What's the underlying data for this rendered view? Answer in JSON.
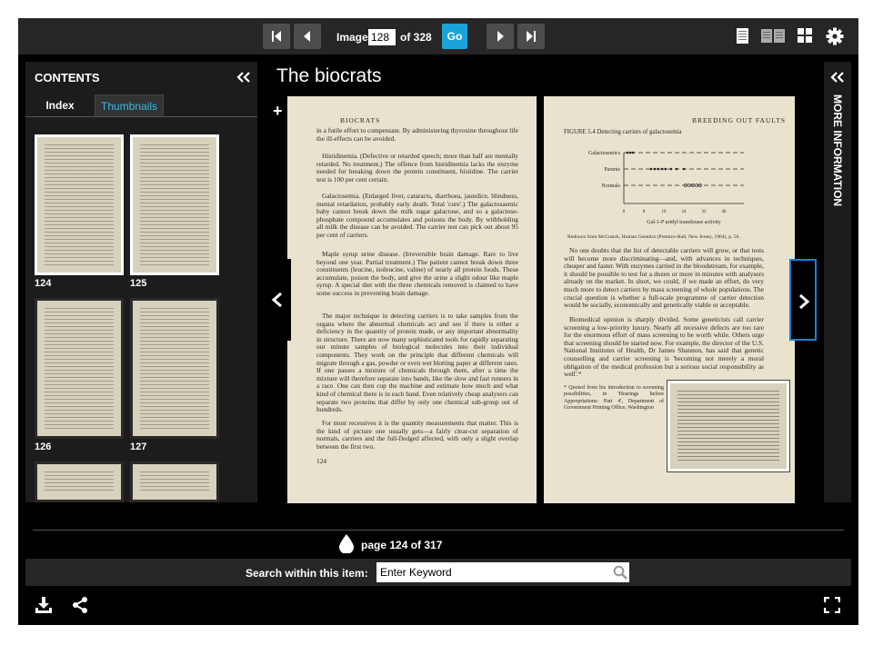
{
  "toolbar": {
    "image_label": "Image",
    "image_value": "128",
    "image_of": "of 328",
    "go_label": "Go"
  },
  "contents": {
    "title": "CONTENTS",
    "tabs": [
      "Index",
      "Thumbnails"
    ],
    "thumbnails": [
      "124",
      "125",
      "126",
      "127",
      "",
      ""
    ]
  },
  "book": {
    "title": "The biocrats"
  },
  "left_page": {
    "header": "BIOCRATS",
    "number": "124",
    "paragraphs": [
      "in a futile effort to compensate. By administering thyroxine throughout life the ill-effects can be avoided.",
      "Histidinemia. (Defective or retarded speech; more than half are mentally retarded. No treatment.) The offence from histidinemia lacks the enzyme needed for breaking down the protein constituent, histidine. The carrier test is 100 per cent certain.",
      "Galactosemia. (Enlarged liver, cataracts, diarrhoea, jaundice, blindness, mental retardation, probably early death. Total 'cure'.) The galactosaemic baby cannot break down the milk sugar galactose, and so a galactose-phosphate compound accumulates and poisons the body. By withholding all milk the disease can be avoided. The carrier test can pick out about 95 per cent of carriers.",
      "Maple syrup urine disease. (Irreversible brain damage. Rare to live beyond one year. Partial treatment.) The patient cannot break down three constituents (leucine, isoleucine, valine) of nearly all protein foods. These accumulate, poison the body, and give the urine a slight odour like maple syrup. A special diet with the three chemicals removed is claimed to have some success in preventing brain damage.",
      "The major technique in detecting carriers is to take samples from the organs where the abnormal chemicals act and see if there is either a deficiency in the quantity of protein made, or any important abnormality in structure. There are now many sophisticated tools for rapidly separating our minute samples of biological molecules into their individual components. They work on the principle that different chemicals will migrate through a gas, powder or even wet blotting paper at different rates. If one passes a mixture of chemicals through them, after a time the mixture will therefore separate into bands, like the slow and fast runners in a race. One can then cop the machine and estimate how much and what kind of chemical there is in each band. Even relatively cheap analysers can separate two proteins that differ by only one chemical sub-group out of hundreds.",
      "For most recessives it is the quantity measurements that matter. This is the kind of picture one usually gets—a fairly clear-cut separation of normals, carriers and the full-fledged affected, with only a slight overlap between the first two."
    ]
  },
  "right_page": {
    "header": "BREEDING OUT FAULTS",
    "figure_caption": "FIGURE 5.4 Detecting carriers of galactosemia",
    "figure_rows": [
      "Galactosemics",
      "Parents",
      "Normals"
    ],
    "figure_axis": "Gal-1-P uridyl transferase activity",
    "figure_ticks": [
      "0",
      "8",
      "16",
      "24",
      "32",
      "40"
    ],
    "figure_credit": "Redrawn from McCusick, Human Genetics (Prentice-Hall, New Jersey, 1964), p. 56.",
    "paragraphs": [
      "No one doubts that the list of detectable carriers will grow, or that tests will become more discriminating—and, with advances in techniques, cheaper and faster. With enzymes carried in the bloodstream, for example, it should be possible to test for a dozen or more in minutes with analysers already on the market. In short, we could, if we made an effort, do very much more to detect carriers by mass screening of whole populations. The crucial question is whether a full-scale programme of carrier detection would be socially, economically and genetically viable or acceptable.",
      "Biomedical opinion is sharply divided. Some geneticists call carrier screening a low-priority luxury. Nearly all recessive defects are too rare for the enormous effort of mass screening to be worth while. Others urge that screening should be started now. For example, the director of the U.S. National Institutes of Health, Dr James Shannon, has said that genetic counselling and carrier screening is 'becoming not merely a moral obligation of the medical profession but a serious social responsibility as well'.*",
      "* Quoted from his introduction to screening possibilities, in 'Hearings before Appropriations: Part 4', Department of Government Printing Office, Washington"
    ]
  },
  "side_panel": {
    "info_label": "MORE INFORMATION"
  },
  "footer": {
    "page_counter": "page 124 of 317",
    "search_label": "Search within this item:",
    "search_placeholder": "Enter Keyword"
  },
  "colors": {
    "accent": "#1aa3d9",
    "tab_active": "#3fb6e6",
    "page_paper": "#e8e2cf",
    "nav_highlight": "#1a7fd4"
  }
}
